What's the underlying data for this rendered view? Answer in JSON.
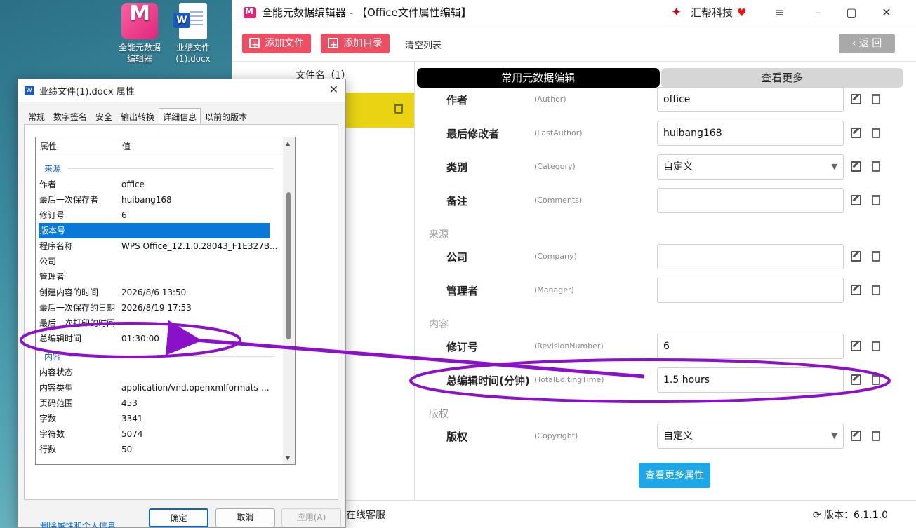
{
  "desktop": {
    "icons": [
      {
        "label_line1": "全能元数据",
        "label_line2": "编辑器",
        "icon": "app-logo-icon"
      },
      {
        "label_line1": "业绩文件",
        "label_line2": "(1).docx",
        "icon": "word-doc-icon"
      }
    ]
  },
  "app": {
    "title": "全能元数据编辑器 - 【Office文件属性编辑】",
    "brand": "汇帮科技",
    "toolbar": {
      "add_file": "添加文件",
      "add_dir": "添加目录",
      "clear": "清空列表",
      "back": "返 回"
    },
    "file_list_header": "文件名（1）",
    "tabs": [
      "常用元数据编辑",
      "查看更多"
    ],
    "rows": [
      {
        "label": "作者",
        "key": "(Author)",
        "value": "office",
        "dropdown": false
      },
      {
        "label": "最后修改者",
        "key": "(LastAuthor)",
        "value": "huibang168",
        "dropdown": false
      },
      {
        "label": "类别",
        "key": "(Category)",
        "value": "自定义",
        "dropdown": true
      },
      {
        "label": "备注",
        "key": "(Comments)",
        "value": "",
        "dropdown": false
      }
    ],
    "section_source": "来源",
    "rows_source": [
      {
        "label": "公司",
        "key": "(Company)",
        "value": ""
      },
      {
        "label": "管理者",
        "key": "(Manager)",
        "value": ""
      }
    ],
    "section_content": "内容",
    "rows_content": [
      {
        "label": "修订号",
        "key": "(RevisionNumber)",
        "value": "6"
      },
      {
        "label": "总编辑时间(分钟)",
        "key": "(TotalEditingTime)",
        "value": "1.5 hours"
      }
    ],
    "section_copyright": "版权",
    "rows_copyright": [
      {
        "label": "版权",
        "key": "(Copyright)",
        "value": "自定义"
      }
    ],
    "more_button": "查看更多属性",
    "statusbar": {
      "service": "在线客服",
      "version": "版本：6.1.1.0"
    }
  },
  "dialog": {
    "title": "业绩文件(1).docx 属性",
    "tabs": [
      "常规",
      "数字签名",
      "安全",
      "输出转换",
      "详细信息",
      "以前的版本"
    ],
    "active_tab": "详细信息",
    "columns": [
      "属性",
      "值"
    ],
    "group_source": "来源",
    "rows": [
      {
        "name": "作者",
        "value": "office"
      },
      {
        "name": "最后一次保存者",
        "value": "huibang168"
      },
      {
        "name": "修订号",
        "value": "6"
      },
      {
        "name": "版本号",
        "value": ""
      },
      {
        "name": "程序名称",
        "value": "WPS Office_12.1.0.28043_F1E327B..."
      },
      {
        "name": "公司",
        "value": ""
      },
      {
        "name": "管理者",
        "value": ""
      },
      {
        "name": "创建内容的时间",
        "value": "2026/8/6 13:50"
      },
      {
        "name": "最后一次保存的日期",
        "value": "2026/8/19 17:53"
      },
      {
        "name": "最后一次打印的时间",
        "value": ""
      },
      {
        "name": "总编辑时间",
        "value": "01:30:00"
      }
    ],
    "group_content": "内容",
    "rows2": [
      {
        "name": "内容状态",
        "value": ""
      },
      {
        "name": "内容类型",
        "value": "application/vnd.openxmlformats-..."
      },
      {
        "name": "页码范围",
        "value": "453"
      },
      {
        "name": "字数",
        "value": "3341"
      },
      {
        "name": "字符数",
        "value": "5074"
      },
      {
        "name": "行数",
        "value": "50"
      }
    ],
    "link": "删除属性和个人信息",
    "buttons": {
      "ok": "确定",
      "cancel": "取消",
      "apply": "应用(A)"
    }
  },
  "colors": {
    "accent_red": "#ef4e62",
    "file_row": "#e9d313",
    "info_blue": "#1ea7e8",
    "annotation": "#8a10c9"
  }
}
